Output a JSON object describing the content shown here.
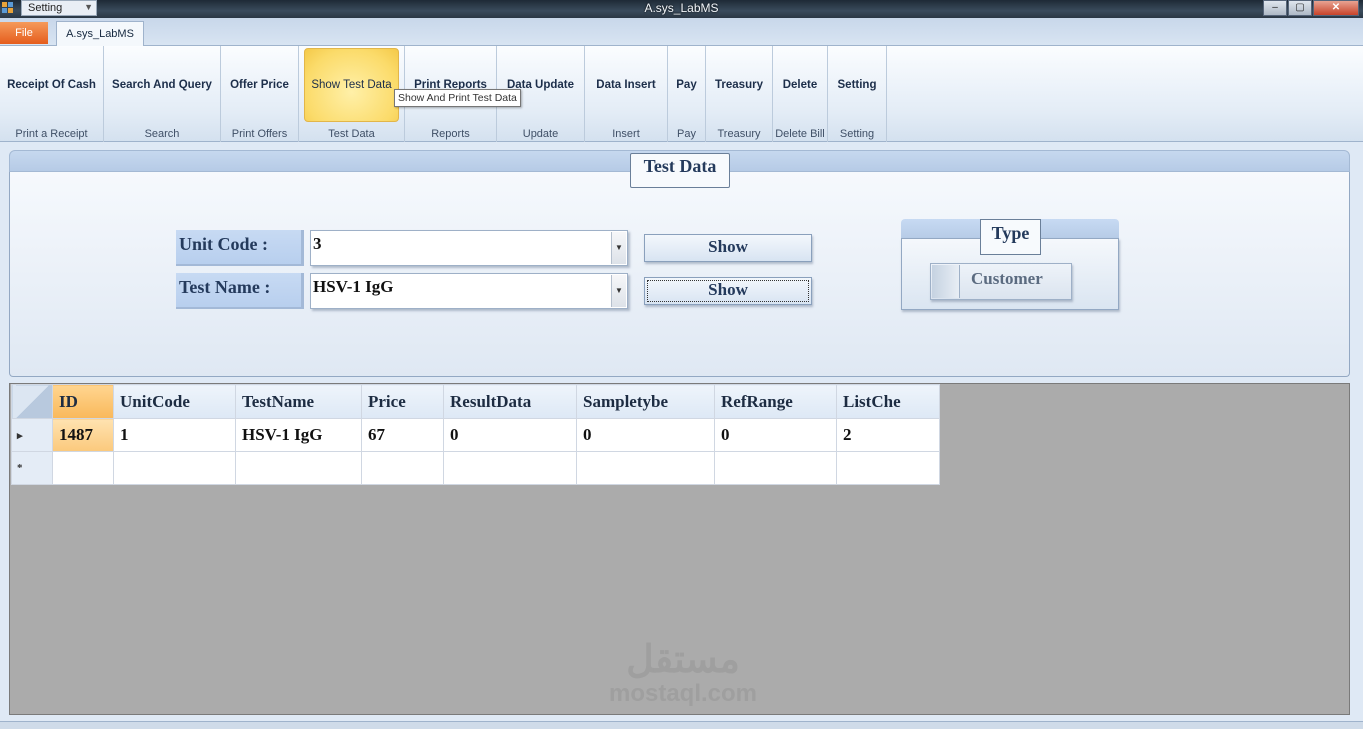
{
  "titlebar": {
    "qat_label": "Setting",
    "title": "A.sys_LabMS",
    "minimize": "–",
    "maximize": "▢",
    "close": "✕"
  },
  "tabs": {
    "file": "File",
    "main": "A.sys_LabMS"
  },
  "ribbon": {
    "groups": [
      {
        "button": "Receipt Of Cash",
        "label": "Print a Receipt"
      },
      {
        "button": "Search And Query",
        "label": "Search"
      },
      {
        "button": "Offer Price",
        "label": "Print Offers"
      },
      {
        "button": "Show Test Data",
        "label": "Test Data"
      },
      {
        "button": "Print Reports",
        "label": "Reports"
      },
      {
        "button": "Data Update",
        "label": "Update"
      },
      {
        "button": "Data Insert",
        "label": "Insert"
      },
      {
        "button": "Pay",
        "label": "Pay"
      },
      {
        "button": "Treasury",
        "label": "Treasury"
      },
      {
        "button": "Delete",
        "label": "Delete Bill"
      },
      {
        "button": "Setting",
        "label": "Setting"
      }
    ],
    "tooltip": "Show And Print Test Data"
  },
  "panel": {
    "title": "Test Data",
    "unit_code_label": "Unit Code :",
    "unit_code_value": "3",
    "test_name_label": "Test Name :",
    "test_name_value": "HSV-1 IgG",
    "show1": "Show",
    "show2": "Show",
    "type_title": "Type",
    "type_toggle": "Customer"
  },
  "grid": {
    "columns": [
      "ID",
      "UnitCode",
      "TestName",
      "Price",
      "ResultData",
      "Sampletybe",
      "RefRange",
      "ListChe"
    ],
    "rows": [
      {
        "marker": "▸",
        "cells": [
          "1487",
          "1",
          "HSV-1 IgG",
          "67",
          "0",
          "0",
          "0",
          "2"
        ]
      },
      {
        "marker": "*",
        "cells": [
          "",
          "",
          "",
          "",
          "",
          "",
          "",
          ""
        ]
      }
    ]
  },
  "watermark": {
    "arabic": "مستقل",
    "latin": "mostaql.com"
  }
}
